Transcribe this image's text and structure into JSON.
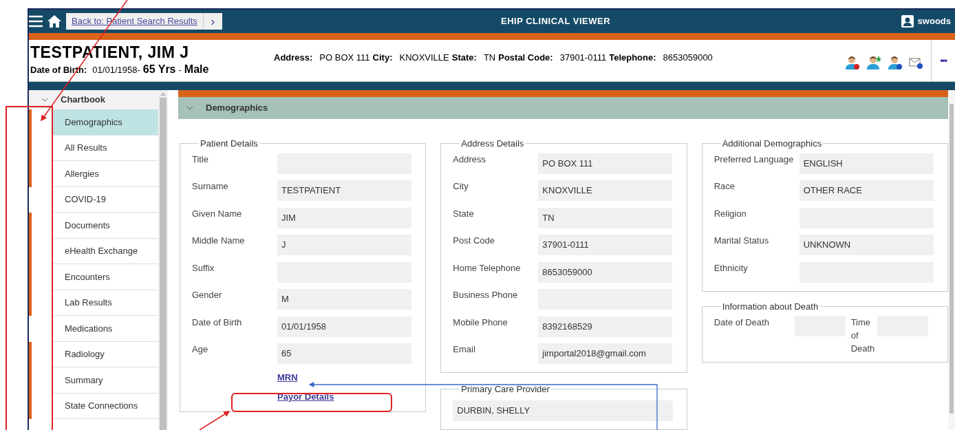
{
  "top_bar": {
    "back_link": "Back to: Patient Search Results",
    "next": "›",
    "title": "EHIP CLINICAL VIEWER",
    "user": "swoods"
  },
  "patient": {
    "name": "TESTPATIENT, JIM J",
    "dob_label": "Date of Birth:",
    "dob": "01/01/1958-",
    "age": "65 Yrs",
    "separator": "-",
    "sex": "Male",
    "contact": [
      {
        "label": "Address:",
        "value": "PO BOX 111"
      },
      {
        "label": "City:",
        "value": "KNOXVILLE"
      },
      {
        "label": "State:",
        "value": "TN"
      },
      {
        "label": "Postal Code:",
        "value": "37901-0111"
      },
      {
        "label": "Telephone:",
        "value": "8653059000"
      }
    ],
    "more": "•••"
  },
  "sidebar": {
    "title": "Chartbook",
    "items": [
      {
        "label": "Demographics",
        "selected": true,
        "marked": true
      },
      {
        "label": "All Results",
        "selected": false,
        "marked": true
      },
      {
        "label": "Allergies",
        "selected": false,
        "marked": true
      },
      {
        "label": "COVID-19",
        "selected": false,
        "marked": false
      },
      {
        "label": "Documents",
        "selected": false,
        "marked": true
      },
      {
        "label": "eHealth Exchange",
        "selected": false,
        "marked": true
      },
      {
        "label": "Encounters",
        "selected": false,
        "marked": true
      },
      {
        "label": "Lab Results",
        "selected": false,
        "marked": true
      },
      {
        "label": "Medications",
        "selected": false,
        "marked": false
      },
      {
        "label": "Radiology",
        "selected": false,
        "marked": true
      },
      {
        "label": "Summary",
        "selected": false,
        "marked": true
      },
      {
        "label": "State Connections",
        "selected": false,
        "marked": true
      }
    ]
  },
  "section": {
    "title": "Demographics",
    "columns": [
      [
        {
          "kind": "form",
          "title": "Patient Details",
          "rows": [
            {
              "label": "Title"
            },
            {
              "label": "Surname",
              "value": "TESTPATIENT"
            },
            {
              "label": "Given Name",
              "value": "JIM"
            },
            {
              "label": "Middle Name",
              "value": "J"
            },
            {
              "label": "Suffix"
            },
            {
              "label": "Gender",
              "value": "M"
            },
            {
              "label": "Date of Birth",
              "value": "01/01/1958"
            },
            {
              "label": "Age",
              "value": "65"
            }
          ],
          "links": [
            "MRN",
            "Payor Details"
          ]
        }
      ],
      [
        {
          "kind": "form",
          "title": "Address Details",
          "rows": [
            {
              "label": "Address",
              "value": "PO BOX 111"
            },
            {
              "label": "City",
              "value": "KNOXVILLE"
            },
            {
              "label": "State",
              "value": "TN"
            },
            {
              "label": "Post Code",
              "value": "37901-0111"
            },
            {
              "label": "Home Telephone",
              "value": "8653059000"
            },
            {
              "label": "Business Phone"
            },
            {
              "label": "Mobile Phone",
              "value": "8392168529"
            },
            {
              "label": "Email",
              "value": "jimportal2018@gmail.com"
            }
          ]
        },
        {
          "kind": "single",
          "title": "Primary Care Provider",
          "value": "DURBIN, SHELLY"
        }
      ],
      [
        {
          "kind": "form",
          "title": "Additional Demographics",
          "rows": [
            {
              "label": "Preferred Language",
              "value": "ENGLISH"
            },
            {
              "label": "Race",
              "value": "OTHER RACE"
            },
            {
              "label": "Religion"
            },
            {
              "label": "Marital Status",
              "value": "UNKNOWN"
            },
            {
              "label": "Ethnicity"
            }
          ]
        },
        {
          "kind": "inline",
          "title": "Information about Death",
          "rows": [
            {
              "label": "Date of Death"
            },
            {
              "label": "Time of Death"
            }
          ]
        }
      ]
    ]
  }
}
